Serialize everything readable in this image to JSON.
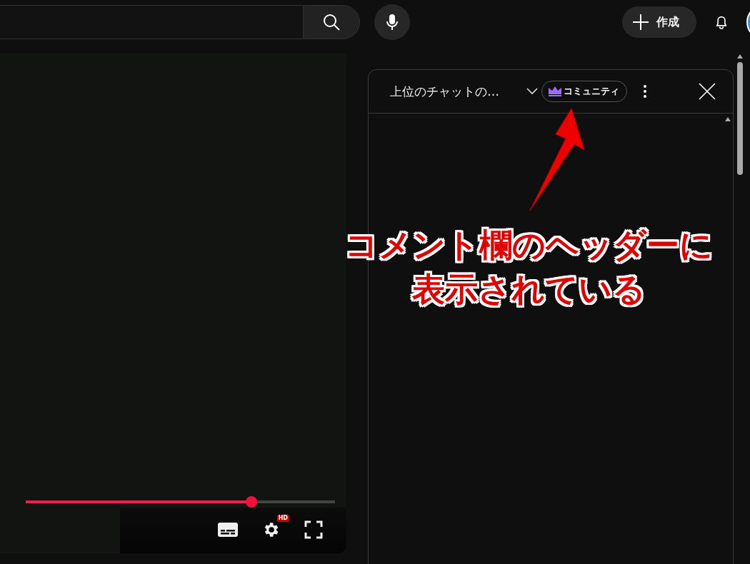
{
  "topbar": {
    "create_button": {
      "label": "作成"
    }
  },
  "player": {
    "progress": {
      "level": 0.73
    },
    "quality_badge": "HD"
  },
  "chat": {
    "title": "上位のチャットの…",
    "badge": "コミュニティ"
  },
  "annotation": {
    "lines": [
      "コメント欄のヘッダーに",
      "表示されている"
    ]
  }
}
